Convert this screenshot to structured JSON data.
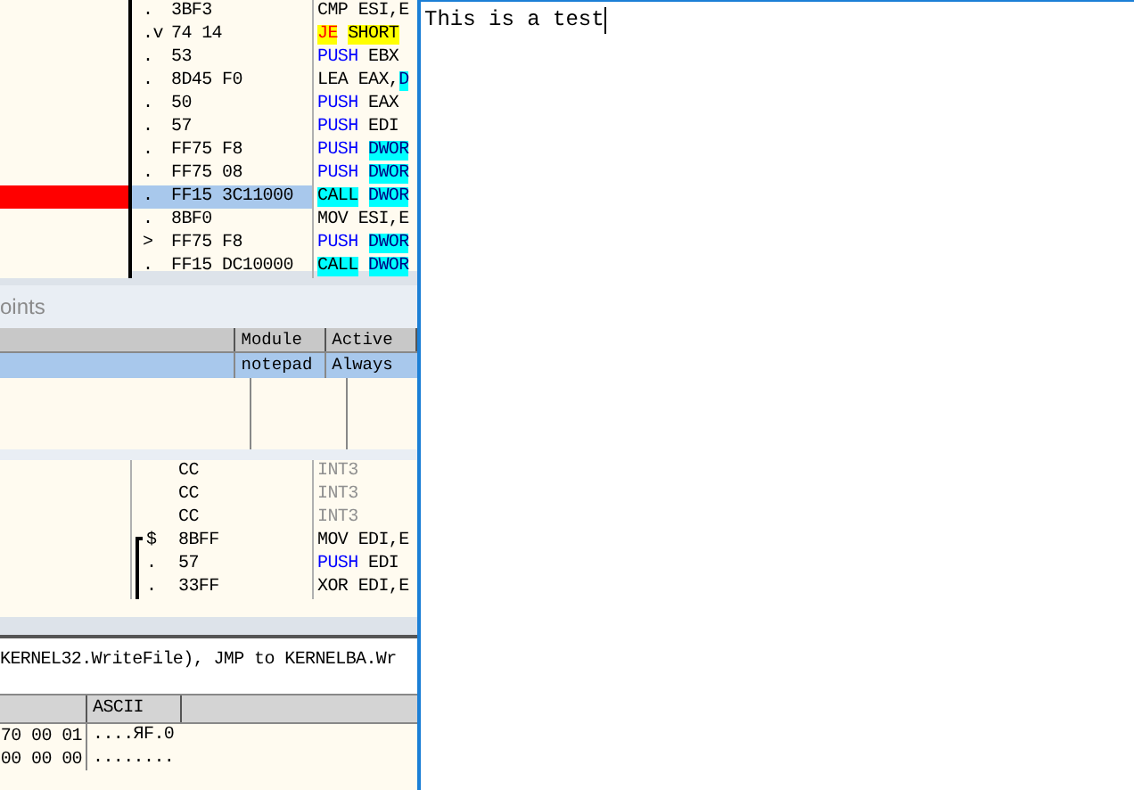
{
  "cpu_top": {
    "rows": [
      {
        "marker": ".",
        "hex": "3BF3",
        "op": {
          "kind": "plain",
          "text": "CMP"
        },
        "args": [
          {
            "kind": "plain",
            "text": "ESI,E"
          }
        ],
        "selected": false,
        "breakpoint": false
      },
      {
        "marker": ".v",
        "hex": "74 14",
        "op": {
          "kind": "jcc",
          "text": "JE"
        },
        "args": [
          {
            "kind": "jarg",
            "text": "SHORT"
          }
        ],
        "selected": false,
        "breakpoint": false
      },
      {
        "marker": ".",
        "hex": "53",
        "op": {
          "kind": "blue",
          "text": "PUSH"
        },
        "args": [
          {
            "kind": "plain",
            "text": "EBX"
          }
        ],
        "selected": false,
        "breakpoint": false
      },
      {
        "marker": ".",
        "hex": "8D45 F0",
        "op": {
          "kind": "plain",
          "text": "LEA"
        },
        "args": [
          {
            "kind": "plain",
            "text": "EAX,"
          },
          {
            "kind": "mem",
            "text": "D"
          }
        ],
        "selected": false,
        "breakpoint": false
      },
      {
        "marker": ".",
        "hex": "50",
        "op": {
          "kind": "blue",
          "text": "PUSH"
        },
        "args": [
          {
            "kind": "plain",
            "text": "EAX"
          }
        ],
        "selected": false,
        "breakpoint": false
      },
      {
        "marker": ".",
        "hex": "57",
        "op": {
          "kind": "blue",
          "text": "PUSH"
        },
        "args": [
          {
            "kind": "plain",
            "text": "EDI"
          }
        ],
        "selected": false,
        "breakpoint": false
      },
      {
        "marker": ".",
        "hex": "FF75 F8",
        "op": {
          "kind": "blue",
          "text": "PUSH"
        },
        "args": [
          {
            "kind": "mem",
            "text": "DWOR"
          }
        ],
        "selected": false,
        "breakpoint": false
      },
      {
        "marker": ".",
        "hex": "FF75 08",
        "op": {
          "kind": "blue",
          "text": "PUSH"
        },
        "args": [
          {
            "kind": "mem",
            "text": "DWOR"
          }
        ],
        "selected": false,
        "breakpoint": false
      },
      {
        "marker": ".",
        "hex": "FF15 3C11000",
        "op": {
          "kind": "call",
          "text": "CALL"
        },
        "args": [
          {
            "kind": "mem",
            "text": "DWOR"
          }
        ],
        "selected": true,
        "breakpoint": true
      },
      {
        "marker": ".",
        "hex": "8BF0",
        "op": {
          "kind": "plain",
          "text": "MOV"
        },
        "args": [
          {
            "kind": "plain",
            "text": "ESI,E"
          }
        ],
        "selected": false,
        "breakpoint": false
      },
      {
        "marker": ">",
        "hex": "FF75 F8",
        "op": {
          "kind": "blue",
          "text": "PUSH"
        },
        "args": [
          {
            "kind": "mem",
            "text": "DWOR"
          }
        ],
        "selected": false,
        "breakpoint": false
      },
      {
        "marker": ".",
        "hex": "FF15 DC10000",
        "op": {
          "kind": "call",
          "text": "CALL"
        },
        "args": [
          {
            "kind": "mem",
            "text": "DWOR"
          }
        ],
        "selected": false,
        "breakpoint": false
      }
    ]
  },
  "breakpoints": {
    "title": "oints",
    "columns": [
      "Module",
      "Active"
    ],
    "rows": [
      {
        "module": "notepad",
        "active": "Always",
        "selected": true
      }
    ]
  },
  "cpu_bottom": {
    "rows": [
      {
        "hex": "CC",
        "op": {
          "kind": "int",
          "text": "INT3"
        }
      },
      {
        "hex": "CC",
        "op": {
          "kind": "int",
          "text": "INT3"
        }
      },
      {
        "hex": "CC",
        "op": {
          "kind": "int",
          "text": "INT3"
        }
      },
      {
        "marker": "$",
        "hex": "8BFF",
        "op": {
          "kind": "plain",
          "text": "MOV"
        },
        "args": [
          {
            "kind": "plain",
            "text": "EDI,E"
          }
        ],
        "in_block": true,
        "block_start": true
      },
      {
        "marker": ".",
        "hex": "57",
        "op": {
          "kind": "blue",
          "text": "PUSH"
        },
        "args": [
          {
            "kind": "plain",
            "text": "EDI"
          }
        ],
        "in_block": true
      },
      {
        "marker": ".",
        "hex": "33FF",
        "op": {
          "kind": "plain",
          "text": "XOR"
        },
        "args": [
          {
            "kind": "plain",
            "text": "EDI,E"
          }
        ],
        "in_block": true
      }
    ]
  },
  "info_line": "KERNEL32.WriteFile), JMP to KERNELBA.Wr",
  "dump": {
    "ascii_header": "ASCII",
    "rows": [
      {
        "hex": "70 00 01",
        "ascii": "....ЯF.0"
      },
      {
        "hex": "00 00 00",
        "ascii": "........"
      }
    ]
  },
  "notepad": {
    "text": "This is a test"
  }
}
